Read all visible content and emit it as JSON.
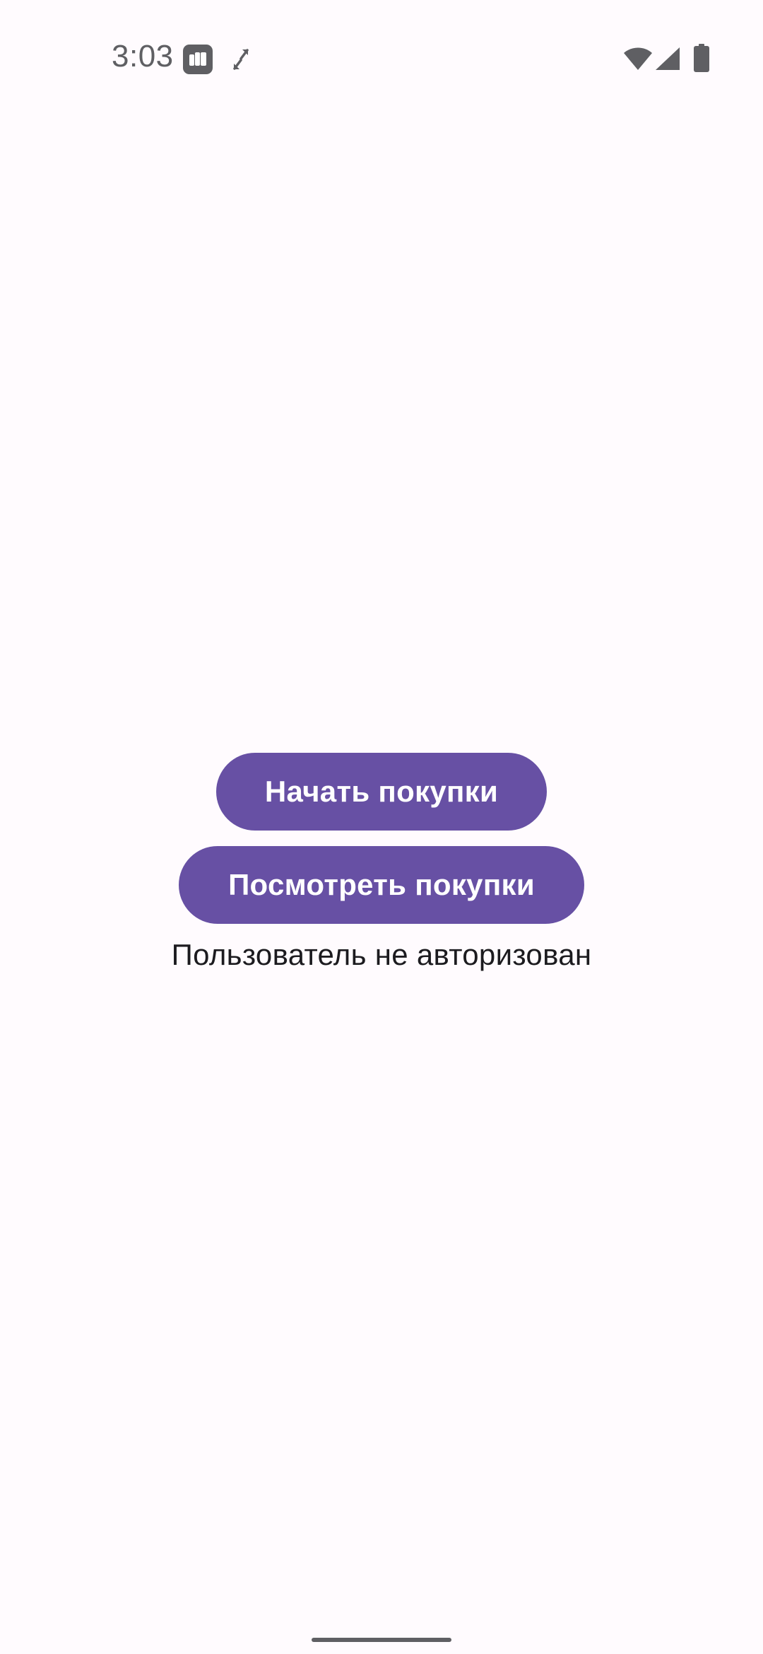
{
  "status_bar": {
    "time": "3:03",
    "icons": [
      "app-notification-icon",
      "expand-icon",
      "wifi-icon",
      "signal-icon",
      "battery-icon"
    ]
  },
  "main": {
    "start_shopping_label": "Начать покупки",
    "view_purchases_label": "Посмотреть покупки",
    "auth_status_text": "Пользователь не авторизован"
  },
  "colors": {
    "background": "#fffbfe",
    "primary": "#6750a4",
    "on_primary": "#ffffff",
    "text": "#1c1b1f",
    "status_icons": "#5f5f63"
  }
}
